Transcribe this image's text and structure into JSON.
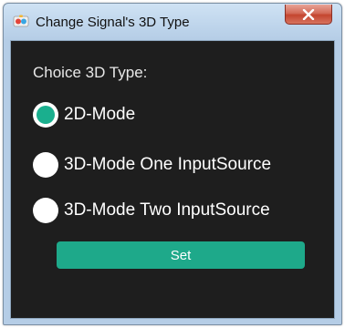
{
  "window": {
    "title": "Change Signal's 3D Type",
    "close_glyph": "✕"
  },
  "icons": {
    "app": "app-icon",
    "close": "close-icon"
  },
  "colors": {
    "accent": "#1ea98a",
    "client_background": "#1e1e1e",
    "close_button": "#c4452f"
  },
  "form": {
    "prompt_label": "Choice 3D Type:",
    "options": [
      {
        "label": "2D-Mode",
        "checked": true
      },
      {
        "label": "3D-Mode One InputSource",
        "checked": false
      },
      {
        "label": "3D-Mode Two InputSource",
        "checked": false
      }
    ],
    "set_label": "Set"
  }
}
